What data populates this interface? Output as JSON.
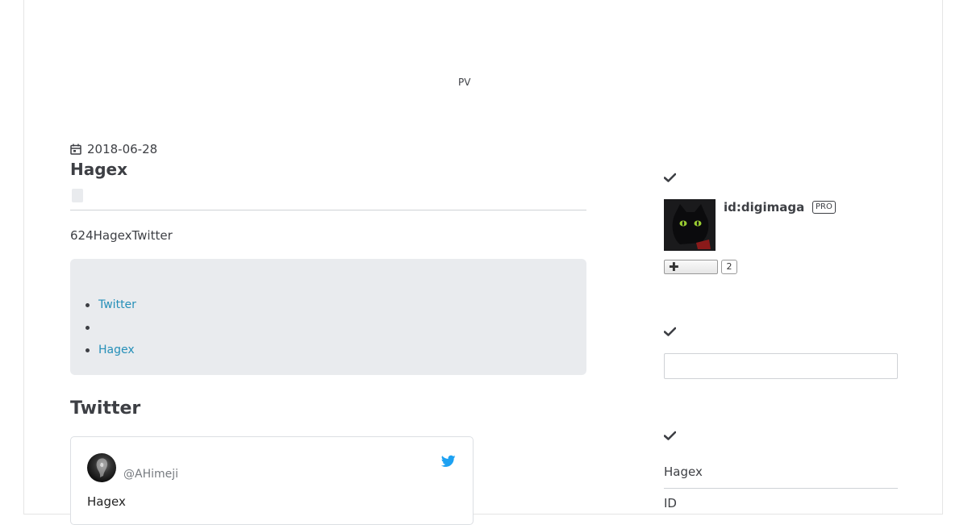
{
  "ad_label": "PV",
  "entry": {
    "date": "2018-06-28",
    "title": "Hagex",
    "lead": "624HagexTwitter",
    "toc": [
      {
        "label": "Twitter"
      },
      {
        "label": ""
      },
      {
        "label": "Hagex"
      }
    ],
    "section_heading": "Twitter"
  },
  "tweet": {
    "handle": "@AHimeji",
    "text": "Hagex",
    "bird_icon": "twitter-bird-icon",
    "bird_color": "#1da1f2"
  },
  "sidebar": {
    "profile": {
      "id_label": "id:digimaga",
      "pro_label": "PRO",
      "follow_count": "2"
    },
    "search": {
      "value": "",
      "placeholder": ""
    },
    "links": [
      {
        "label": "Hagex"
      },
      {
        "label": "ID"
      }
    ]
  },
  "colors": {
    "link": "#258fb8",
    "toc_background": "#e9ebee",
    "text": "#3d3f44"
  }
}
